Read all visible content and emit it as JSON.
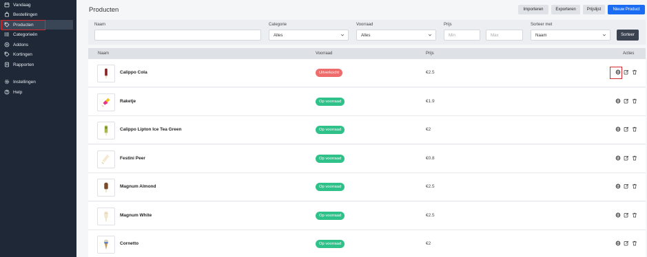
{
  "sidebar": {
    "items": [
      {
        "label": "Vandaag",
        "icon": "calendar-icon"
      },
      {
        "label": "Bestellingen",
        "icon": "bag-icon"
      },
      {
        "label": "Producten",
        "icon": "tag-icon"
      },
      {
        "label": "Categorieën",
        "icon": "list-icon"
      },
      {
        "label": "Addons",
        "icon": "plus-circle-icon"
      },
      {
        "label": "Kortingen",
        "icon": "tag-icon"
      },
      {
        "label": "Rapporten",
        "icon": "report-icon"
      },
      {
        "label": "Instellingen",
        "icon": "gear-icon"
      },
      {
        "label": "Help",
        "icon": "question-icon"
      }
    ]
  },
  "header": {
    "title": "Producten",
    "buttons": {
      "import": "Importeren",
      "export": "Exporteren",
      "pricelist": "Prijslijst",
      "new": "Nieuw Product"
    }
  },
  "filters": {
    "name_label": "Naam",
    "name_value": "",
    "category_label": "Categorie",
    "category_value": "Alles",
    "stock_label": "Voorraad",
    "stock_value": "Alles",
    "price_label": "Prijs",
    "price_min_placeholder": "Min",
    "price_max_placeholder": "Max",
    "sort_label": "Sorteer met",
    "sort_value": "Naam",
    "sort_button": "Sorteer"
  },
  "table": {
    "headers": {
      "name": "Naam",
      "stock": "Voorraad",
      "price": "Prijs",
      "actions": "Acties"
    },
    "rows": [
      {
        "name": "Calippo Cola",
        "stock": "Uitverkocht",
        "status": "out",
        "price": "€2.5"
      },
      {
        "name": "Raketje",
        "stock": "Op voorraad",
        "status": "in",
        "price": "€1.9"
      },
      {
        "name": "Calippo Lipton Ice Tea Green",
        "stock": "Op voorraad",
        "status": "in",
        "price": "€2"
      },
      {
        "name": "Festini Peer",
        "stock": "Op voorraad",
        "status": "in",
        "price": "€0.8"
      },
      {
        "name": "Magnum Almond",
        "stock": "Op voorraad",
        "status": "in",
        "price": "€2.5"
      },
      {
        "name": "Magnum White",
        "stock": "Op voorraad",
        "status": "in",
        "price": "€2.5"
      },
      {
        "name": "Cornetto",
        "stock": "Op voorraad",
        "status": "in",
        "price": "€2"
      }
    ]
  },
  "colors": {
    "sidebar_bg": "#1e2837",
    "primary": "#1a6cf2",
    "out_of_stock": "#ef6c6c",
    "in_stock": "#2ec28a",
    "highlight": "#d9262a"
  }
}
